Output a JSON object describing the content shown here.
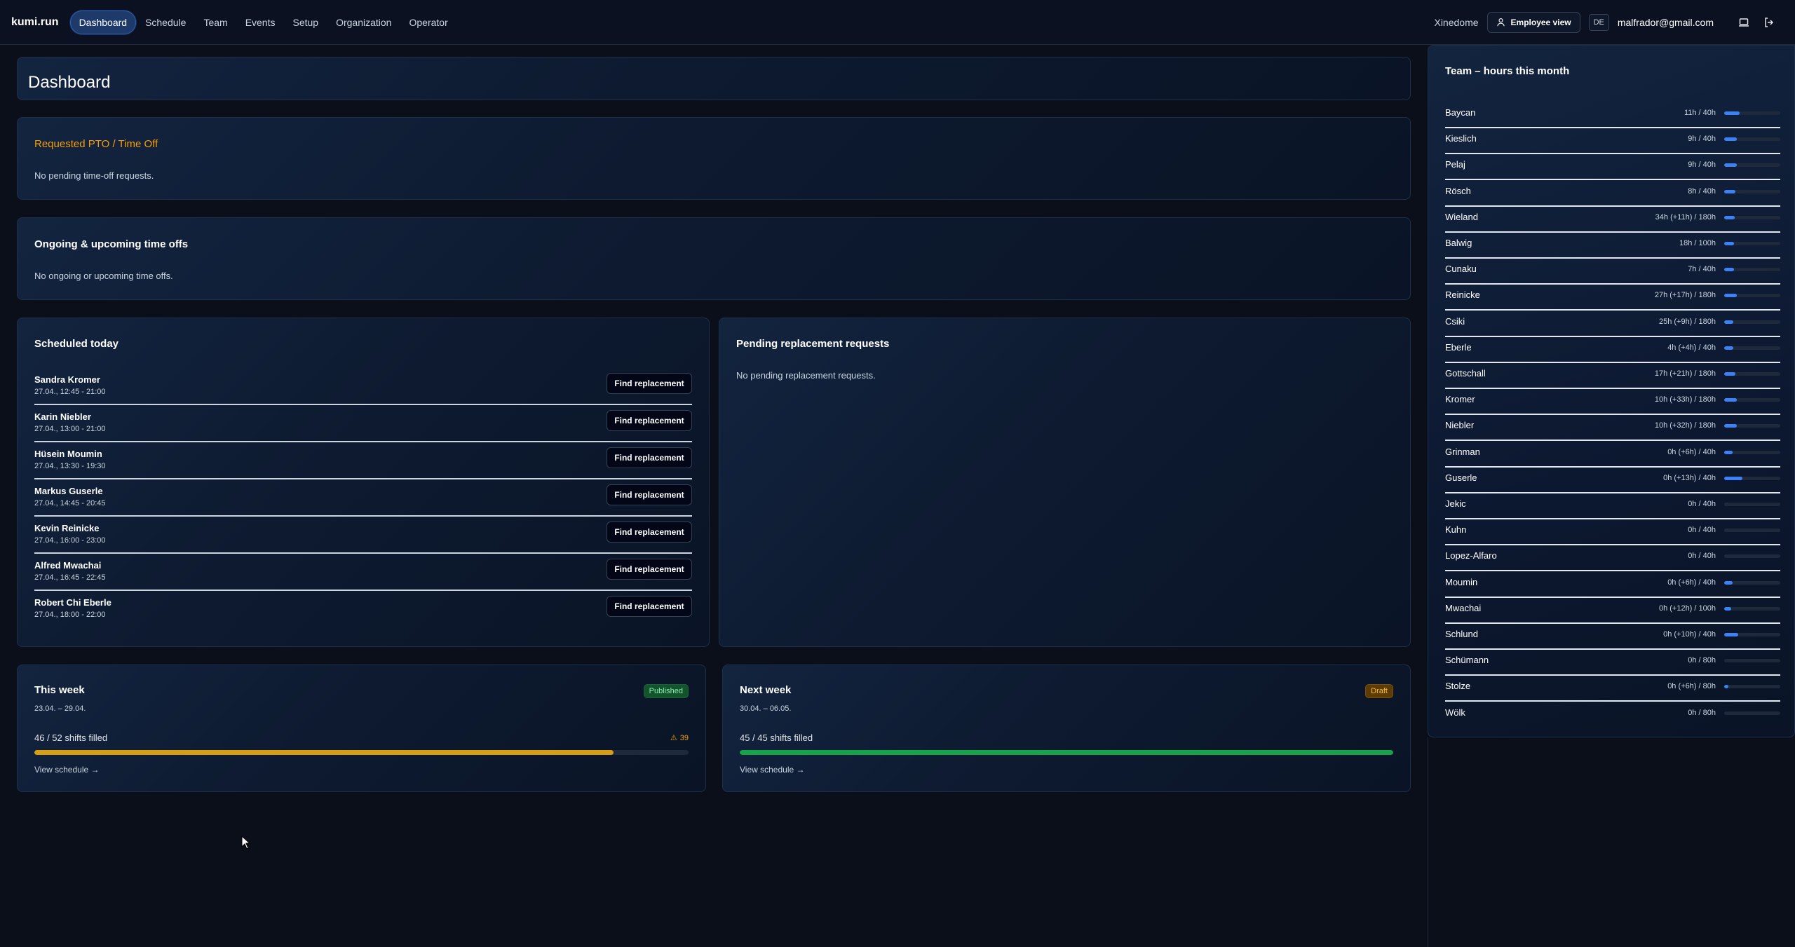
{
  "nav": {
    "brand": "kumi.run",
    "items": [
      "Dashboard",
      "Schedule",
      "Team",
      "Events",
      "Setup",
      "Organization",
      "Operator"
    ],
    "org": "Xinedome",
    "employee_view": "Employee view",
    "lang": "DE",
    "email": "malfrador@gmail.com"
  },
  "page_title": "Dashboard",
  "pto": {
    "title": "Requested PTO / Time Off",
    "empty": "No pending time-off requests."
  },
  "timeoffs": {
    "title": "Ongoing & upcoming time offs",
    "empty": "No ongoing or upcoming time offs."
  },
  "scheduled": {
    "title": "Scheduled today",
    "button": "Find replacement",
    "rows": [
      {
        "name": "Sandra Kromer",
        "time": "27.04., 12:45 - 21:00"
      },
      {
        "name": "Karin Niebler",
        "time": "27.04., 13:00 - 21:00"
      },
      {
        "name": "Hüsein Moumin",
        "time": "27.04., 13:30 - 19:30"
      },
      {
        "name": "Markus Guserle",
        "time": "27.04., 14:45 - 20:45"
      },
      {
        "name": "Kevin Reinicke",
        "time": "27.04., 16:00 - 23:00"
      },
      {
        "name": "Alfred Mwachai",
        "time": "27.04., 16:45 - 22:45"
      },
      {
        "name": "Robert Chi Eberle",
        "time": "27.04., 18:00 - 22:00"
      }
    ]
  },
  "replacement": {
    "title": "Pending replacement requests",
    "empty": "No pending replacement requests."
  },
  "this_week": {
    "title": "This week",
    "badge": "Published",
    "range": "23.04. – 29.04.",
    "filled": "46 / 52 shifts filled",
    "warning": "39",
    "progress": 0.885,
    "color": "#d69e14",
    "link": "View schedule →"
  },
  "next_week": {
    "title": "Next week",
    "badge": "Draft",
    "range": "30.04. – 06.05.",
    "filled": "45 / 45 shifts filled",
    "progress": 1.0,
    "color": "#16a34a",
    "link": "View schedule →"
  },
  "team": {
    "title": "Team – hours this month",
    "rows": [
      {
        "name": "Baycan",
        "hours": "11h / 40h",
        "fill": 0.275
      },
      {
        "name": "Kieslich",
        "hours": "9h / 40h",
        "fill": 0.225
      },
      {
        "name": "Pelaj",
        "hours": "9h / 40h",
        "fill": 0.225
      },
      {
        "name": "Rösch",
        "hours": "8h / 40h",
        "fill": 0.2
      },
      {
        "name": "Wieland",
        "hours": "34h (+11h) / 180h",
        "fill": 0.19
      },
      {
        "name": "Balwig",
        "hours": "18h / 100h",
        "fill": 0.18
      },
      {
        "name": "Cunaku",
        "hours": "7h / 40h",
        "fill": 0.175
      },
      {
        "name": "Reinicke",
        "hours": "27h (+17h) / 180h",
        "fill": 0.22
      },
      {
        "name": "Csiki",
        "hours": "25h (+9h) / 180h",
        "fill": 0.16
      },
      {
        "name": "Eberle",
        "hours": "4h (+4h) / 40h",
        "fill": 0.16
      },
      {
        "name": "Gottschall",
        "hours": "17h (+21h) / 180h",
        "fill": 0.2
      },
      {
        "name": "Kromer",
        "hours": "10h (+33h) / 180h",
        "fill": 0.22
      },
      {
        "name": "Niebler",
        "hours": "10h (+32h) / 180h",
        "fill": 0.22
      },
      {
        "name": "Grinman",
        "hours": "0h (+6h) / 40h",
        "fill": 0.15
      },
      {
        "name": "Guserle",
        "hours": "0h (+13h) / 40h",
        "fill": 0.32
      },
      {
        "name": "Jekic",
        "hours": "0h / 40h",
        "fill": 0.0
      },
      {
        "name": "Kuhn",
        "hours": "0h / 40h",
        "fill": 0.0
      },
      {
        "name": "Lopez-Alfaro",
        "hours": "0h / 40h",
        "fill": 0.0
      },
      {
        "name": "Moumin",
        "hours": "0h (+6h) / 40h",
        "fill": 0.15
      },
      {
        "name": "Mwachai",
        "hours": "0h (+12h) / 100h",
        "fill": 0.12
      },
      {
        "name": "Schlund",
        "hours": "0h (+10h) / 40h",
        "fill": 0.25
      },
      {
        "name": "Schümann",
        "hours": "0h / 80h",
        "fill": 0.0
      },
      {
        "name": "Stolze",
        "hours": "0h (+6h) / 80h",
        "fill": 0.075
      },
      {
        "name": "Wölk",
        "hours": "0h / 80h",
        "fill": 0.0
      }
    ]
  }
}
